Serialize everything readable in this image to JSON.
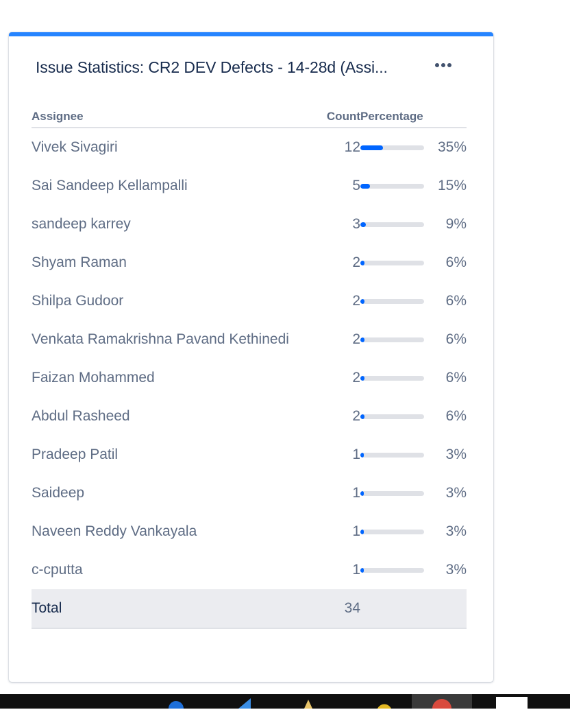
{
  "gadget": {
    "title": "Issue Statistics: CR2 DEV Defects - 14-28d (Assi...",
    "accent_color": "#2684ff",
    "bar_color": "#0065ff",
    "more_icon": "more-horizontal-icon"
  },
  "table": {
    "headers": {
      "assignee": "Assignee",
      "count": "Count",
      "percentage": "Percentage"
    },
    "rows": [
      {
        "assignee": "Vivek Sivagiri",
        "count": "12",
        "percent": "35%",
        "fill": 0.35
      },
      {
        "assignee": "Sai Sandeep Kellampalli",
        "count": "5",
        "percent": "15%",
        "fill": 0.15
      },
      {
        "assignee": "sandeep karrey",
        "count": "3",
        "percent": "9%",
        "fill": 0.09
      },
      {
        "assignee": "Shyam Raman",
        "count": "2",
        "percent": "6%",
        "fill": 0.06
      },
      {
        "assignee": "Shilpa Gudoor",
        "count": "2",
        "percent": "6%",
        "fill": 0.06
      },
      {
        "assignee": "Venkata Ramakrishna Pavand Kethinedi",
        "count": "2",
        "percent": "6%",
        "fill": 0.06
      },
      {
        "assignee": "Faizan Mohammed",
        "count": "2",
        "percent": "6%",
        "fill": 0.06
      },
      {
        "assignee": "Abdul Rasheed",
        "count": "2",
        "percent": "6%",
        "fill": 0.06
      },
      {
        "assignee": "Pradeep Patil",
        "count": "1",
        "percent": "3%",
        "fill": 0.03
      },
      {
        "assignee": "Saideep",
        "count": "1",
        "percent": "3%",
        "fill": 0.03
      },
      {
        "assignee": "Naveen Reddy Vankayala",
        "count": "1",
        "percent": "3%",
        "fill": 0.03
      },
      {
        "assignee": "c-cputta",
        "count": "1",
        "percent": "3%",
        "fill": 0.03
      }
    ],
    "total": {
      "label": "Total",
      "count": "34"
    }
  }
}
